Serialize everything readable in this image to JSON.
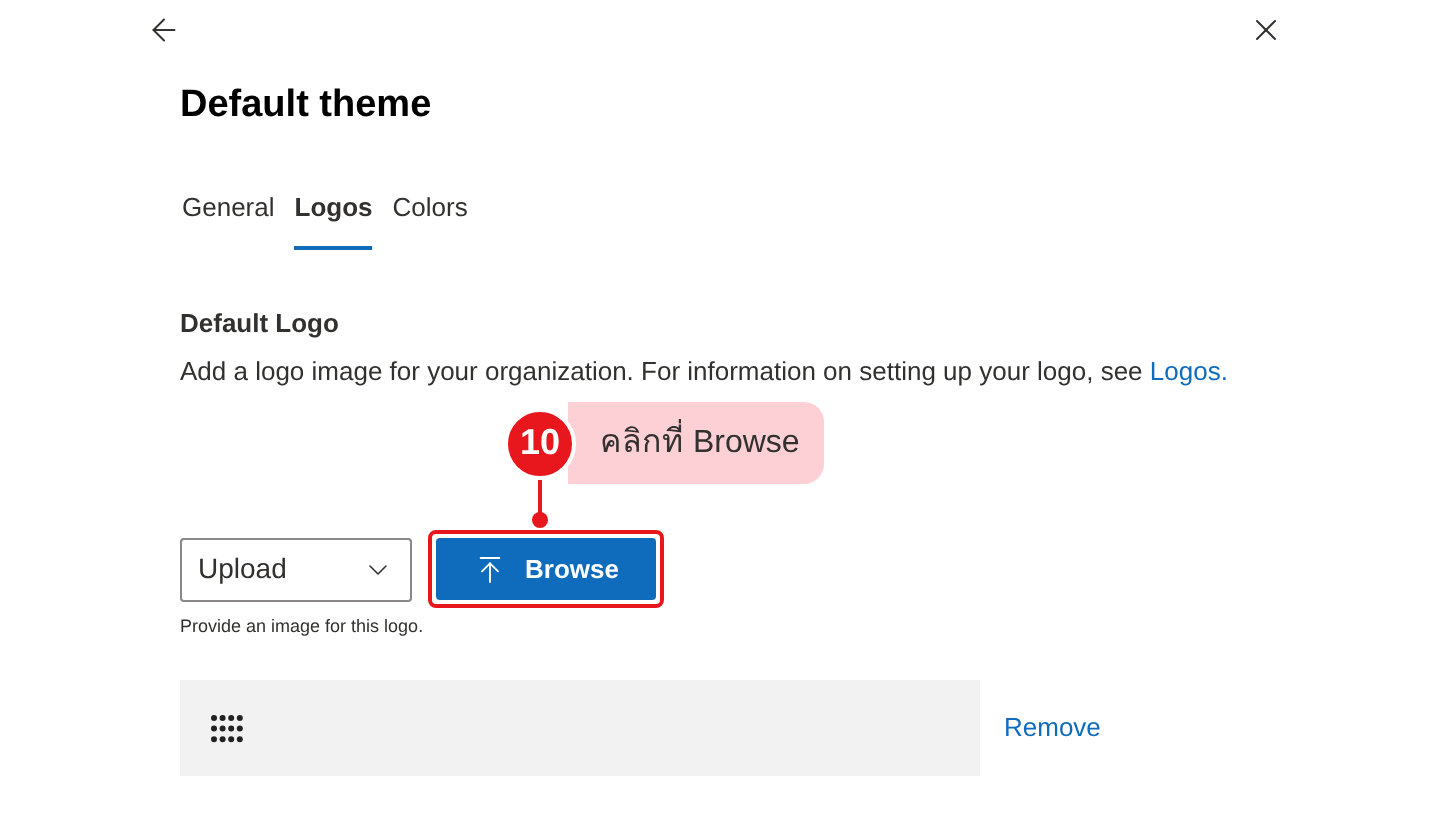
{
  "title": "Default theme",
  "tabs": [
    {
      "label": "General",
      "selected": false
    },
    {
      "label": "Logos",
      "selected": true
    },
    {
      "label": "Colors",
      "selected": false
    }
  ],
  "section": {
    "heading": "Default Logo",
    "description": "Add a logo image for your organization. For information on setting up your logo, see",
    "link": "Logos."
  },
  "source_dropdown": {
    "value": "Upload"
  },
  "browse_button": {
    "label": "Browse"
  },
  "helper_text": "Provide an image for this logo.",
  "logo_row": {
    "action": "Remove"
  },
  "callout": {
    "step": "10",
    "text": "คลิกที่ Browse"
  }
}
